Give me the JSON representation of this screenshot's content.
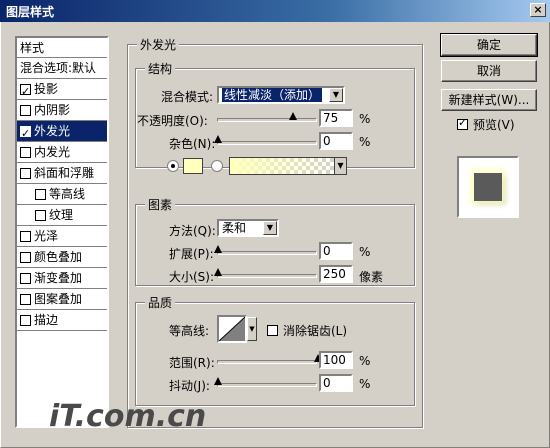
{
  "window": {
    "title": "图层样式",
    "close_glyph": "×"
  },
  "style_list": {
    "header": "样式",
    "items": [
      {
        "label": "混合选项:默认",
        "checkbox": false,
        "checked": false,
        "sub": false,
        "active": false
      },
      {
        "label": "投影",
        "checkbox": true,
        "checked": true,
        "sub": false,
        "active": false
      },
      {
        "label": "内阴影",
        "checkbox": true,
        "checked": false,
        "sub": false,
        "active": false
      },
      {
        "label": "外发光",
        "checkbox": true,
        "checked": true,
        "sub": false,
        "active": true
      },
      {
        "label": "内发光",
        "checkbox": true,
        "checked": false,
        "sub": false,
        "active": false
      },
      {
        "label": "斜面和浮雕",
        "checkbox": true,
        "checked": false,
        "sub": false,
        "active": false
      },
      {
        "label": "等高线",
        "checkbox": true,
        "checked": false,
        "sub": true,
        "active": false
      },
      {
        "label": "纹理",
        "checkbox": true,
        "checked": false,
        "sub": true,
        "active": false
      },
      {
        "label": "光泽",
        "checkbox": true,
        "checked": false,
        "sub": false,
        "active": false
      },
      {
        "label": "颜色叠加",
        "checkbox": true,
        "checked": false,
        "sub": false,
        "active": false
      },
      {
        "label": "渐变叠加",
        "checkbox": true,
        "checked": false,
        "sub": false,
        "active": false
      },
      {
        "label": "图案叠加",
        "checkbox": true,
        "checked": false,
        "sub": false,
        "active": false
      },
      {
        "label": "描边",
        "checkbox": true,
        "checked": false,
        "sub": false,
        "active": false
      }
    ]
  },
  "outer_glow": {
    "title": "外发光",
    "structure": {
      "title": "结构",
      "blend_mode_label": "混合模式:",
      "blend_mode_value": "线性减淡（添加）",
      "opacity_label": "不透明度(O):",
      "opacity_value": "75",
      "opacity_fraction": 0.75,
      "noise_label": "杂色(N):",
      "noise_value": "0",
      "noise_fraction": 0,
      "percent": "%",
      "glow_color": "#ffffbe"
    },
    "elements": {
      "title": "图素",
      "technique_label": "方法(Q):",
      "technique_value": "柔和",
      "spread_label": "扩展(P):",
      "spread_value": "0",
      "spread_fraction": 0,
      "size_label": "大小(S):",
      "size_value": "250",
      "size_fraction": 0.0,
      "size_unit": "像素",
      "percent": "%"
    },
    "quality": {
      "title": "品质",
      "contour_label": "等高线:",
      "antialias_label": "消除锯齿(L)",
      "range_label": "范围(R):",
      "range_value": "100",
      "range_fraction": 1.0,
      "jitter_label": "抖动(J):",
      "jitter_value": "0",
      "jitter_fraction": 0,
      "percent": "%"
    }
  },
  "buttons": {
    "ok": "确定",
    "cancel": "取消",
    "new_style": "新建样式(W)...",
    "preview_label": "预览(V)"
  },
  "watermark": "iT.com.cn"
}
